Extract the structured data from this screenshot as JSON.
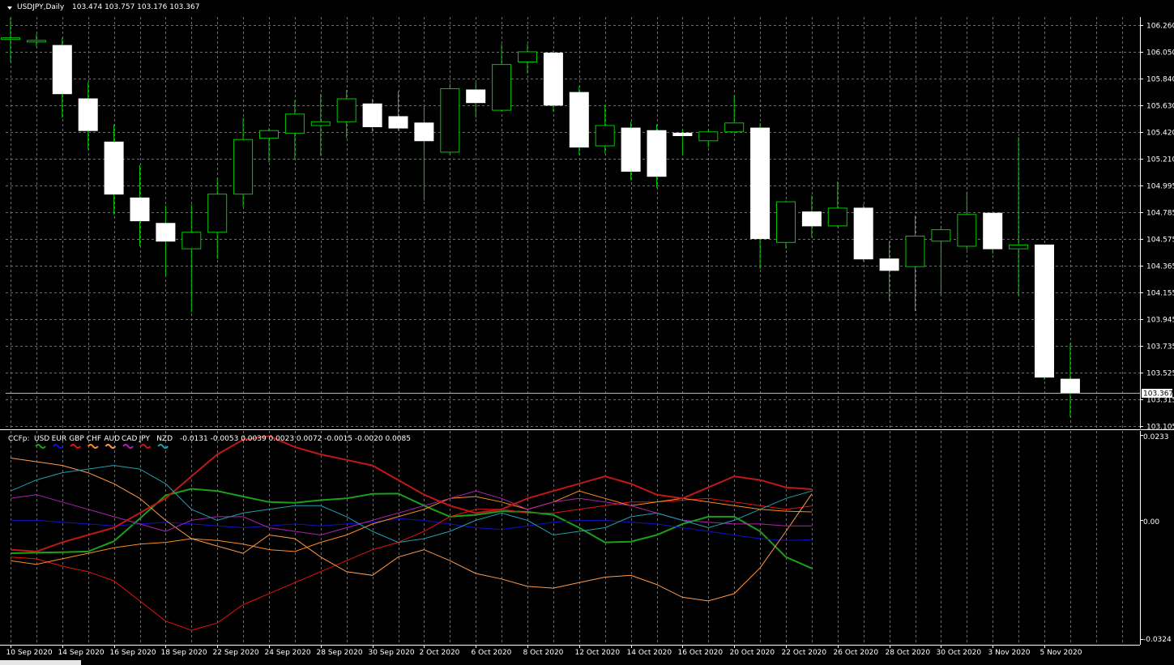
{
  "main": {
    "symbol_label": "USDJPY,Daily",
    "ohlc_label": "103.474 103.757 103.176 103.367",
    "current_price": "103.367",
    "price_ticks": [
      "106.260",
      "106.050",
      "105.840",
      "105.630",
      "105.420",
      "105.210",
      "104.995",
      "104.785",
      "104.575",
      "104.365",
      "104.155",
      "103.945",
      "103.735",
      "103.525",
      "103.315",
      "103.105"
    ]
  },
  "sub": {
    "name": "CCFp:",
    "currencies": [
      "USD",
      "EUR",
      "GBP",
      "CHF",
      "AUD",
      "CAD",
      "JPY",
      "NZD"
    ],
    "values_text": "-0.0131 -0.0053 0.0039 0.0023 0.0072 -0.0015 -0.0020 0.0085",
    "axis_labels": [
      "0.0233",
      "0.00",
      "-0.0324"
    ],
    "colors": [
      "#1aa01a",
      "#1010c8",
      "#e81010",
      "#ff8c1a",
      "#ff9a4a",
      "#b020b0",
      "#c01818",
      "#20a0b0"
    ]
  },
  "date_labels": [
    "10 Sep 2020",
    "14 Sep 2020",
    "16 Sep 2020",
    "18 Sep 2020",
    "22 Sep 2020",
    "24 Sep 2020",
    "28 Sep 2020",
    "30 Sep 2020",
    "2 Oct 2020",
    "6 Oct 2020",
    "8 Oct 2020",
    "12 Oct 2020",
    "14 Oct 2020",
    "16 Oct 2020",
    "20 Oct 2020",
    "22 Oct 2020",
    "26 Oct 2020",
    "28 Oct 2020",
    "30 Oct 2020",
    "3 Nov 2020",
    "5 Nov 2020"
  ],
  "colors": {
    "background": "#000000",
    "grid": "#6e6e6e",
    "bull": "#00c800",
    "bear_fill": "#ffffff",
    "text": "#ffffff",
    "price_line": "#b4b4b4"
  },
  "chart_data": [
    {
      "type": "candlestick",
      "title": "USDJPY,Daily",
      "ylim": [
        103.105,
        106.26
      ],
      "candles": [
        {
          "o": 106.16,
          "h": 106.32,
          "l": 105.97,
          "c": 106.16
        },
        {
          "o": 106.13,
          "h": 106.19,
          "l": 106.09,
          "c": 106.14
        },
        {
          "o": 106.1,
          "h": 106.16,
          "l": 105.53,
          "c": 105.72
        },
        {
          "o": 105.68,
          "h": 105.81,
          "l": 105.28,
          "c": 105.43
        },
        {
          "o": 105.34,
          "h": 105.48,
          "l": 104.77,
          "c": 104.93
        },
        {
          "o": 104.9,
          "h": 105.16,
          "l": 104.52,
          "c": 104.72
        },
        {
          "o": 104.7,
          "h": 104.84,
          "l": 104.28,
          "c": 104.56
        },
        {
          "o": 104.5,
          "h": 104.85,
          "l": 104.0,
          "c": 104.63
        },
        {
          "o": 104.63,
          "h": 105.06,
          "l": 104.42,
          "c": 104.93
        },
        {
          "o": 104.93,
          "h": 105.53,
          "l": 104.83,
          "c": 105.36
        },
        {
          "o": 105.37,
          "h": 105.45,
          "l": 105.18,
          "c": 105.43
        },
        {
          "o": 105.41,
          "h": 105.67,
          "l": 105.2,
          "c": 105.56
        },
        {
          "o": 105.47,
          "h": 105.72,
          "l": 105.23,
          "c": 105.5
        },
        {
          "o": 105.5,
          "h": 105.75,
          "l": 105.37,
          "c": 105.68
        },
        {
          "o": 105.64,
          "h": 105.68,
          "l": 105.42,
          "c": 105.46
        },
        {
          "o": 105.54,
          "h": 105.74,
          "l": 105.43,
          "c": 105.45
        },
        {
          "o": 105.49,
          "h": 105.62,
          "l": 104.88,
          "c": 105.35
        },
        {
          "o": 105.26,
          "h": 105.8,
          "l": 105.25,
          "c": 105.76
        },
        {
          "o": 105.75,
          "h": 105.81,
          "l": 105.53,
          "c": 105.65
        },
        {
          "o": 105.59,
          "h": 106.11,
          "l": 105.58,
          "c": 105.95
        },
        {
          "o": 105.97,
          "h": 106.11,
          "l": 105.88,
          "c": 106.05
        },
        {
          "o": 106.04,
          "h": 106.06,
          "l": 105.58,
          "c": 105.63
        },
        {
          "o": 105.73,
          "h": 105.78,
          "l": 105.24,
          "c": 105.3
        },
        {
          "o": 105.31,
          "h": 105.63,
          "l": 105.25,
          "c": 105.47
        },
        {
          "o": 105.45,
          "h": 105.5,
          "l": 105.04,
          "c": 105.11
        },
        {
          "o": 105.43,
          "h": 105.48,
          "l": 104.98,
          "c": 105.07
        },
        {
          "o": 105.41,
          "h": 105.44,
          "l": 105.24,
          "c": 105.39
        },
        {
          "o": 105.35,
          "h": 105.44,
          "l": 105.3,
          "c": 105.42
        },
        {
          "o": 105.42,
          "h": 105.71,
          "l": 105.41,
          "c": 105.49
        },
        {
          "o": 105.45,
          "h": 105.49,
          "l": 104.34,
          "c": 104.58
        },
        {
          "o": 104.55,
          "h": 104.88,
          "l": 104.5,
          "c": 104.87
        },
        {
          "o": 104.79,
          "h": 104.92,
          "l": 104.59,
          "c": 104.68
        },
        {
          "o": 104.68,
          "h": 105.03,
          "l": 104.67,
          "c": 104.82
        },
        {
          "o": 104.82,
          "h": 104.85,
          "l": 104.4,
          "c": 104.42
        },
        {
          "o": 104.42,
          "h": 104.56,
          "l": 104.09,
          "c": 104.33
        },
        {
          "o": 104.36,
          "h": 104.76,
          "l": 104.01,
          "c": 104.6
        },
        {
          "o": 104.56,
          "h": 104.68,
          "l": 104.13,
          "c": 104.65
        },
        {
          "o": 104.52,
          "h": 104.95,
          "l": 104.49,
          "c": 104.77
        },
        {
          "o": 104.78,
          "h": 104.79,
          "l": 104.46,
          "c": 104.5
        },
        {
          "o": 104.5,
          "h": 105.38,
          "l": 104.13,
          "c": 104.53
        },
        {
          "o": 104.53,
          "h": 104.53,
          "l": 103.47,
          "c": 103.49
        },
        {
          "o": 103.474,
          "h": 103.757,
          "l": 103.176,
          "c": 103.367
        }
      ]
    },
    {
      "type": "line",
      "title": "CCFp:",
      "ylim": [
        -0.0324,
        0.0233
      ],
      "series": [
        {
          "name": "USD",
          "color": "#1aa01a",
          "values": [
            -0.009,
            -0.0088,
            -0.0087,
            -0.0085,
            -0.0057,
            0.0005,
            0.0068,
            0.0086,
            0.008,
            0.0065,
            0.005,
            0.0048,
            0.0055,
            0.006,
            0.0072,
            0.0073,
            0.004,
            0.001,
            0.0015,
            0.0025,
            0.0023,
            0.0015,
            -0.002,
            -0.006,
            -0.0058,
            -0.004,
            -0.001,
            0.001,
            0.001,
            -0.003,
            -0.01,
            -0.0131
          ]
        },
        {
          "name": "EUR",
          "color": "#1010c8",
          "values": [
            0.0,
            0.0,
            -0.0005,
            -0.001,
            -0.0015,
            -0.001,
            -0.0005,
            -0.001,
            -0.0015,
            -0.002,
            -0.0015,
            -0.001,
            -0.0015,
            -0.001,
            -0.0005,
            0.0005,
            0.0,
            -0.001,
            -0.002,
            -0.0025,
            -0.0015,
            -0.0005,
            0.0,
            0.0,
            -0.0005,
            -0.001,
            -0.002,
            -0.003,
            -0.004,
            -0.005,
            -0.0055,
            -0.0053
          ]
        },
        {
          "name": "GBP",
          "color": "#e81010",
          "values": [
            -0.01,
            -0.0105,
            -0.0125,
            -0.014,
            -0.0165,
            -0.022,
            -0.0275,
            -0.03,
            -0.028,
            -0.023,
            -0.02,
            -0.017,
            -0.014,
            -0.011,
            -0.008,
            -0.006,
            -0.003,
            0.001,
            0.003,
            0.003,
            0.002,
            0.002,
            0.003,
            0.004,
            0.005,
            0.005,
            0.0055,
            0.006,
            0.005,
            0.004,
            0.003,
            0.0039
          ]
        },
        {
          "name": "CHF",
          "color": "#ff8c1a",
          "values": [
            -0.011,
            -0.012,
            -0.0105,
            -0.009,
            -0.0075,
            -0.0065,
            -0.006,
            -0.005,
            -0.0055,
            -0.0065,
            -0.008,
            -0.0085,
            -0.006,
            -0.004,
            -0.001,
            0.001,
            0.003,
            0.006,
            0.0065,
            0.005,
            0.003,
            0.005,
            0.008,
            0.006,
            0.004,
            0.005,
            0.006,
            0.005,
            0.004,
            0.003,
            0.0025,
            0.0023
          ]
        },
        {
          "name": "AUD",
          "color": "#ff9a4a",
          "values": [
            0.017,
            0.016,
            0.015,
            0.013,
            0.01,
            0.006,
            0.0,
            -0.005,
            -0.007,
            -0.009,
            -0.004,
            -0.005,
            -0.01,
            -0.014,
            -0.015,
            -0.01,
            -0.008,
            -0.011,
            -0.0145,
            -0.016,
            -0.018,
            -0.0185,
            -0.017,
            -0.0155,
            -0.015,
            -0.0175,
            -0.021,
            -0.022,
            -0.02,
            -0.013,
            -0.003,
            0.0072
          ]
        },
        {
          "name": "CAD",
          "color": "#b020b0",
          "values": [
            0.006,
            0.007,
            0.005,
            0.003,
            0.001,
            -0.001,
            -0.003,
            0.0,
            0.001,
            0.001,
            -0.002,
            -0.003,
            -0.004,
            -0.002,
            0.0,
            0.002,
            0.004,
            0.006,
            0.008,
            0.006,
            0.003,
            0.005,
            0.006,
            0.005,
            0.004,
            0.002,
            0.0,
            -0.0005,
            -0.001,
            -0.001,
            -0.0015,
            -0.0015
          ]
        },
        {
          "name": "JPY",
          "color": "#c01818",
          "values": [
            -0.008,
            -0.0085,
            -0.006,
            -0.004,
            -0.002,
            0.002,
            0.006,
            0.012,
            0.018,
            0.022,
            0.023,
            0.02,
            0.018,
            0.0165,
            0.015,
            0.011,
            0.007,
            0.004,
            0.002,
            0.003,
            0.006,
            0.008,
            0.01,
            0.012,
            0.01,
            0.007,
            0.006,
            0.009,
            0.012,
            0.011,
            0.009,
            0.0085
          ]
        },
        {
          "name": "NZD",
          "color": "#20a0b0",
          "values": [
            0.008,
            0.011,
            0.013,
            0.014,
            0.015,
            0.014,
            0.01,
            0.003,
            0.0,
            0.002,
            0.003,
            0.004,
            0.004,
            0.001,
            -0.003,
            -0.006,
            -0.005,
            -0.003,
            0.0,
            0.002,
            0.0,
            -0.004,
            -0.003,
            -0.002,
            0.001,
            0.002,
            0.0,
            -0.002,
            0.0,
            0.003,
            0.006,
            0.008
          ]
        }
      ]
    }
  ]
}
